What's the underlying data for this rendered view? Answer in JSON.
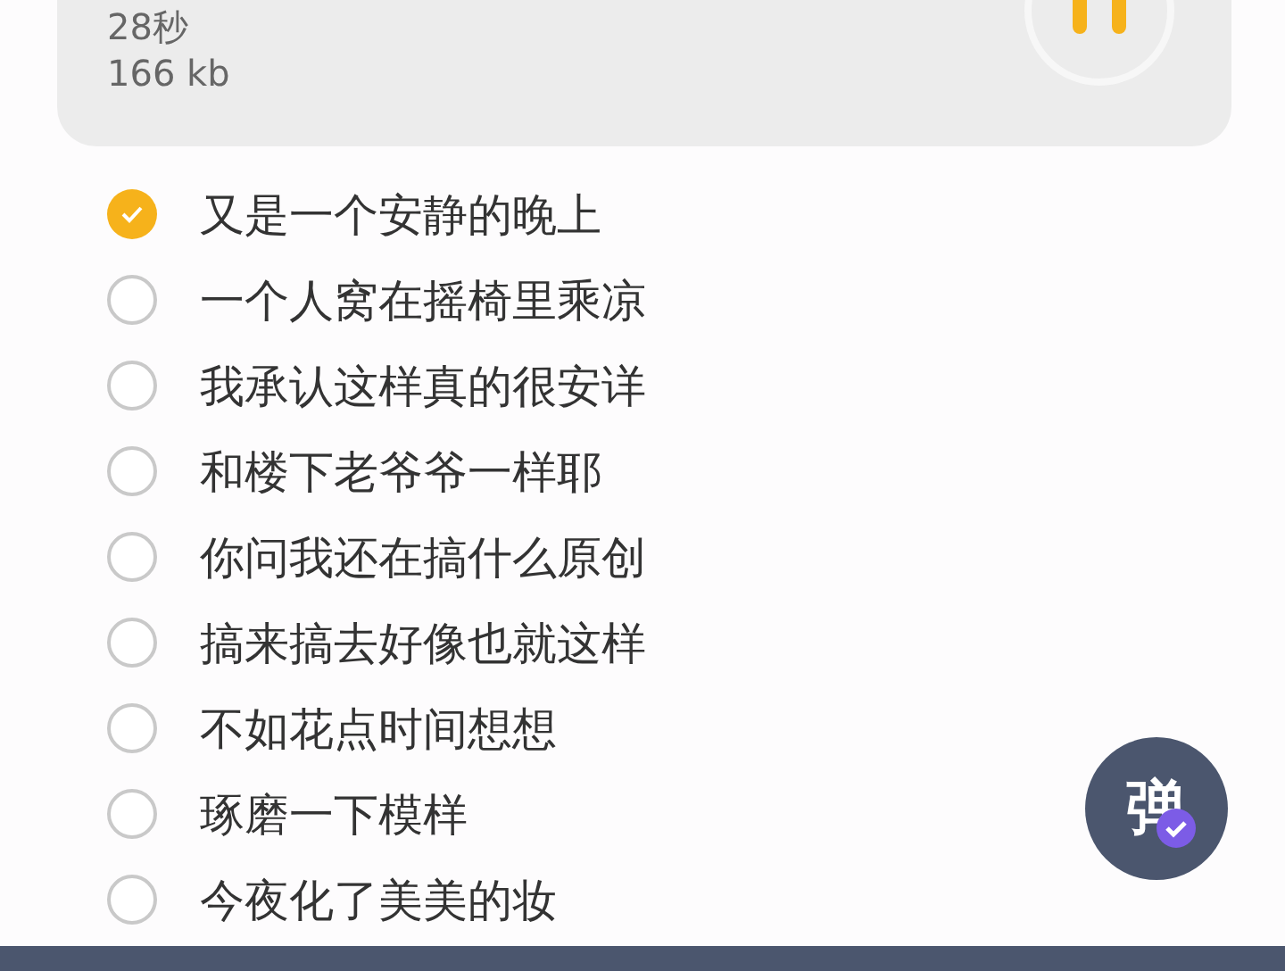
{
  "recording": {
    "duration": "28秒",
    "size": "166 kb"
  },
  "lyrics": [
    {
      "text": "又是一个安静的晚上",
      "checked": true
    },
    {
      "text": "一个人窝在摇椅里乘凉",
      "checked": false
    },
    {
      "text": "我承认这样真的很安详",
      "checked": false
    },
    {
      "text": "和楼下老爷爷一样耶",
      "checked": false
    },
    {
      "text": "你问我还在搞什么原创",
      "checked": false
    },
    {
      "text": "搞来搞去好像也就这样",
      "checked": false
    },
    {
      "text": "不如花点时间想想",
      "checked": false
    },
    {
      "text": "琢磨一下模样",
      "checked": false
    },
    {
      "text": "今夜化了美美的妆",
      "checked": false
    }
  ],
  "danmaku_button": {
    "label": "弹"
  }
}
